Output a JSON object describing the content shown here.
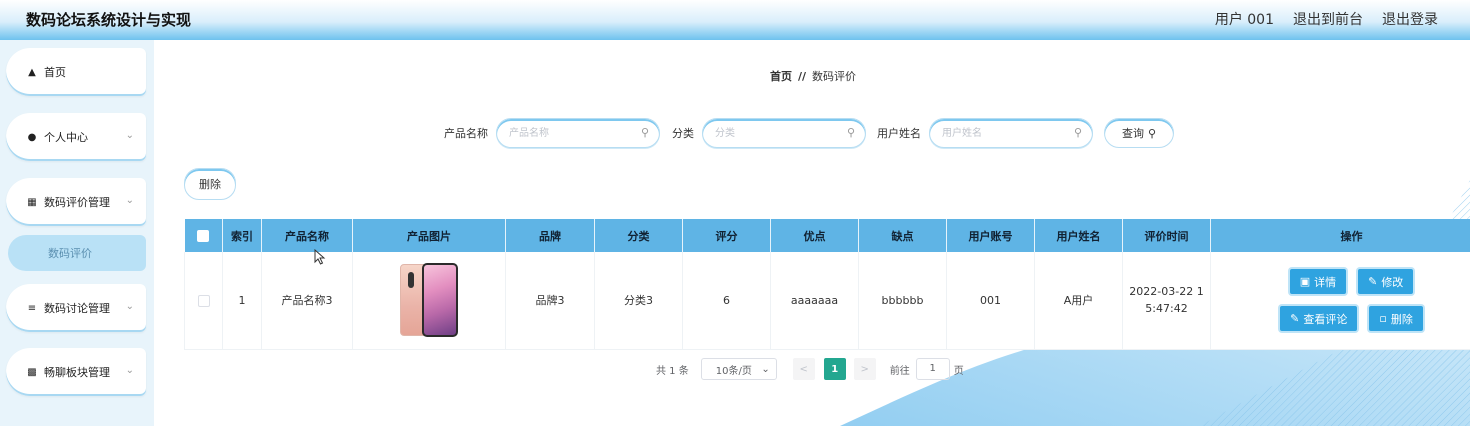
{
  "header": {
    "title": "数码论坛系统设计与实现",
    "user": "用户 001",
    "to_front": "退出到前台",
    "logout": "退出登录"
  },
  "sidebar": {
    "items": [
      {
        "label": "首页",
        "icon": "home-icon"
      },
      {
        "label": "个人中心",
        "icon": "user-icon"
      },
      {
        "label": "数码评价管理",
        "icon": "grid-icon"
      },
      {
        "label": "数码讨论管理",
        "icon": "list-icon"
      },
      {
        "label": "畅聊板块管理",
        "icon": "clipboard-icon"
      }
    ],
    "sub_active": "数码评价"
  },
  "breadcrumb": {
    "home": "首页",
    "sep": "//",
    "current": "数码评价"
  },
  "search": {
    "product_label": "产品名称",
    "product_placeholder": "产品名称",
    "category_label": "分类",
    "category_placeholder": "分类",
    "username_label": "用户姓名",
    "username_placeholder": "用户姓名",
    "query_label": "查询"
  },
  "delete_label": "删除",
  "table": {
    "headers": [
      "索引",
      "产品名称",
      "产品图片",
      "品牌",
      "分类",
      "评分",
      "优点",
      "缺点",
      "用户账号",
      "用户姓名",
      "评价时间",
      "操作"
    ],
    "rows": [
      {
        "index": "1",
        "product": "产品名称3",
        "brand": "品牌3",
        "category": "分类3",
        "score": "6",
        "pros": "aaaaaaa",
        "cons": "bbbbbb",
        "account": "001",
        "username": "A用户",
        "time_line1": "2022-03-22 1",
        "time_line2": "5:47:42"
      }
    ],
    "actions": {
      "detail": "详情",
      "edit": "修改",
      "view_comments": "查看评论",
      "delete": "删除"
    }
  },
  "pager": {
    "total": "共 1 条",
    "page_size": "10条/页",
    "current_page": "1",
    "goto": "前往",
    "goto_value": "1",
    "page_unit": "页"
  },
  "colors": {
    "accent": "#2fa3e0",
    "header_row": "#5fb4e5",
    "page_active": "#23a790"
  }
}
